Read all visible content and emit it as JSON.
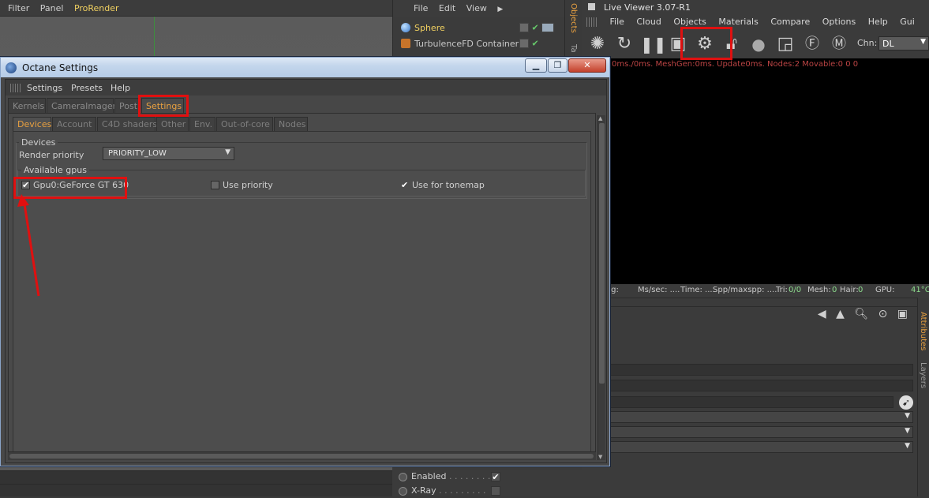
{
  "viewport": {
    "menu": [
      "Filter",
      "Panel",
      "ProRender"
    ],
    "nav_icons": "✥ ✣ ↻ ▢"
  },
  "object_manager": {
    "menu": [
      "File",
      "Edit",
      "View"
    ],
    "objects": [
      {
        "name": "Sphere",
        "color": "#f0d060"
      },
      {
        "name": "TurbulenceFD Container",
        "color": "#cfcfcf"
      }
    ],
    "side_tab": "Objects",
    "side_tab2": "Ta"
  },
  "live_viewer": {
    "title": "Live Viewer 3.07-R1",
    "menu": [
      "File",
      "Cloud",
      "Objects",
      "Materials",
      "Compare",
      "Options",
      "Help",
      "Gui"
    ],
    "channel_label": "Chn:",
    "channel_value": "DL",
    "status_top": "0ms./0ms. MeshGen:0ms. Update0ms. Nodes:2 Movable:0  0 0",
    "status_bar": {
      "rendering": "ing:",
      "ms_sec": "Ms/sec: ....",
      "time": "Time: ....",
      "spp": "Spp/maxspp: ....",
      "tri_label": "Tri:",
      "tri": "0/0",
      "mesh_label": "Mesh:",
      "mesh": "0",
      "hair_label": "Hair:",
      "hair": "0",
      "gpu_label": "GPU:",
      "gpu_temp": "41°C"
    }
  },
  "attributes": {
    "side_tab": "Attributes",
    "side_tab2": "Layers"
  },
  "basic": {
    "enabled_label": "Enabled",
    "xray_label": "X-Ray",
    "dots": ". . . . . . . . ."
  },
  "octane": {
    "title": "Octane Settings",
    "menu": [
      "Settings",
      "Presets",
      "Help"
    ],
    "tabs_top": [
      "Kernels",
      "CameraImager",
      "Post",
      "Settings"
    ],
    "active_top_tab": "Settings",
    "tabs_sub": [
      "Devices",
      "Account",
      "C4D shaders",
      "Other",
      "Env.",
      "Out-of-core",
      "Nodes"
    ],
    "active_sub_tab": "Devices",
    "devices_group": "Devices",
    "render_priority_label": "Render priority",
    "render_priority_value": "PRIORITY_LOW",
    "gpus_group": "Available gpus",
    "gpu_name": "Gpu0:GeForce GT 630",
    "gpu_enabled": true,
    "use_priority_label": "Use priority",
    "use_priority_checked": false,
    "use_tonemap_label": "Use for tonemap",
    "use_tonemap_checked": true,
    "btn_minimize": "▁",
    "btn_maximize": "❐",
    "btn_close": "✕"
  },
  "colors": {
    "annotation_red": "#e01010",
    "accent_orange": "#e8a040",
    "status_green": "#8ddc8d"
  }
}
